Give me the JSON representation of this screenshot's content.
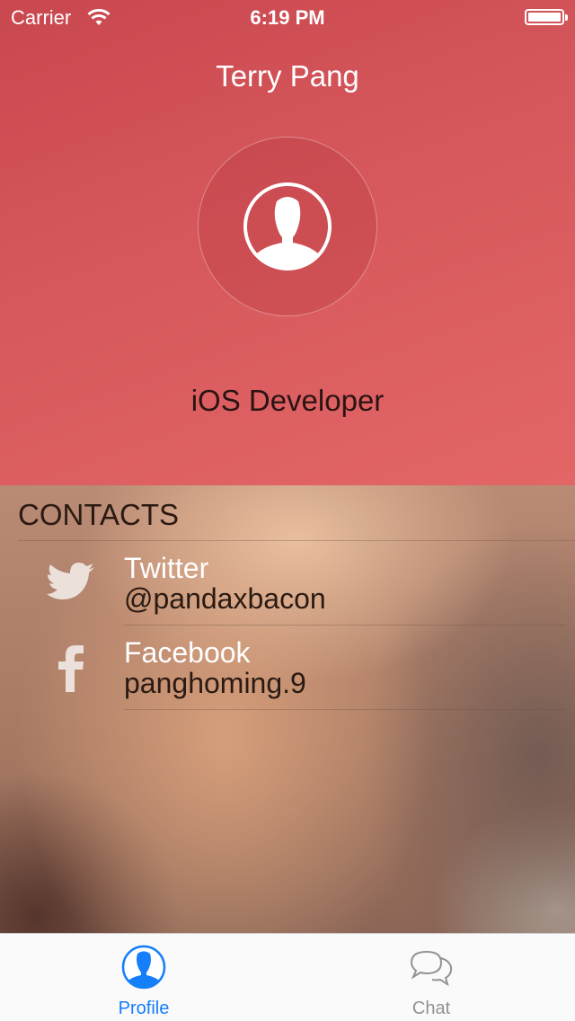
{
  "status_bar": {
    "carrier": "Carrier",
    "time": "6:19 PM",
    "battery_level": 1.0
  },
  "profile": {
    "name": "Terry Pang",
    "role": "iOS Developer",
    "avatar_icon": "person-silhouette-icon"
  },
  "contacts": {
    "title": "CONTACTS",
    "items": [
      {
        "icon": "twitter-bird-icon",
        "label": "Twitter",
        "handle": "@pandaxbacon"
      },
      {
        "icon": "facebook-f-icon",
        "label": "Facebook",
        "handle": "panghoming.9"
      }
    ]
  },
  "tab_bar": {
    "tabs": [
      {
        "label": "Profile",
        "icon": "profile-person-icon",
        "selected": true
      },
      {
        "label": "Chat",
        "icon": "chat-bubbles-icon",
        "selected": false
      }
    ]
  },
  "colors": {
    "header_red": "#d6585c",
    "tab_selected": "#157efb",
    "tab_unselected": "#929292"
  }
}
